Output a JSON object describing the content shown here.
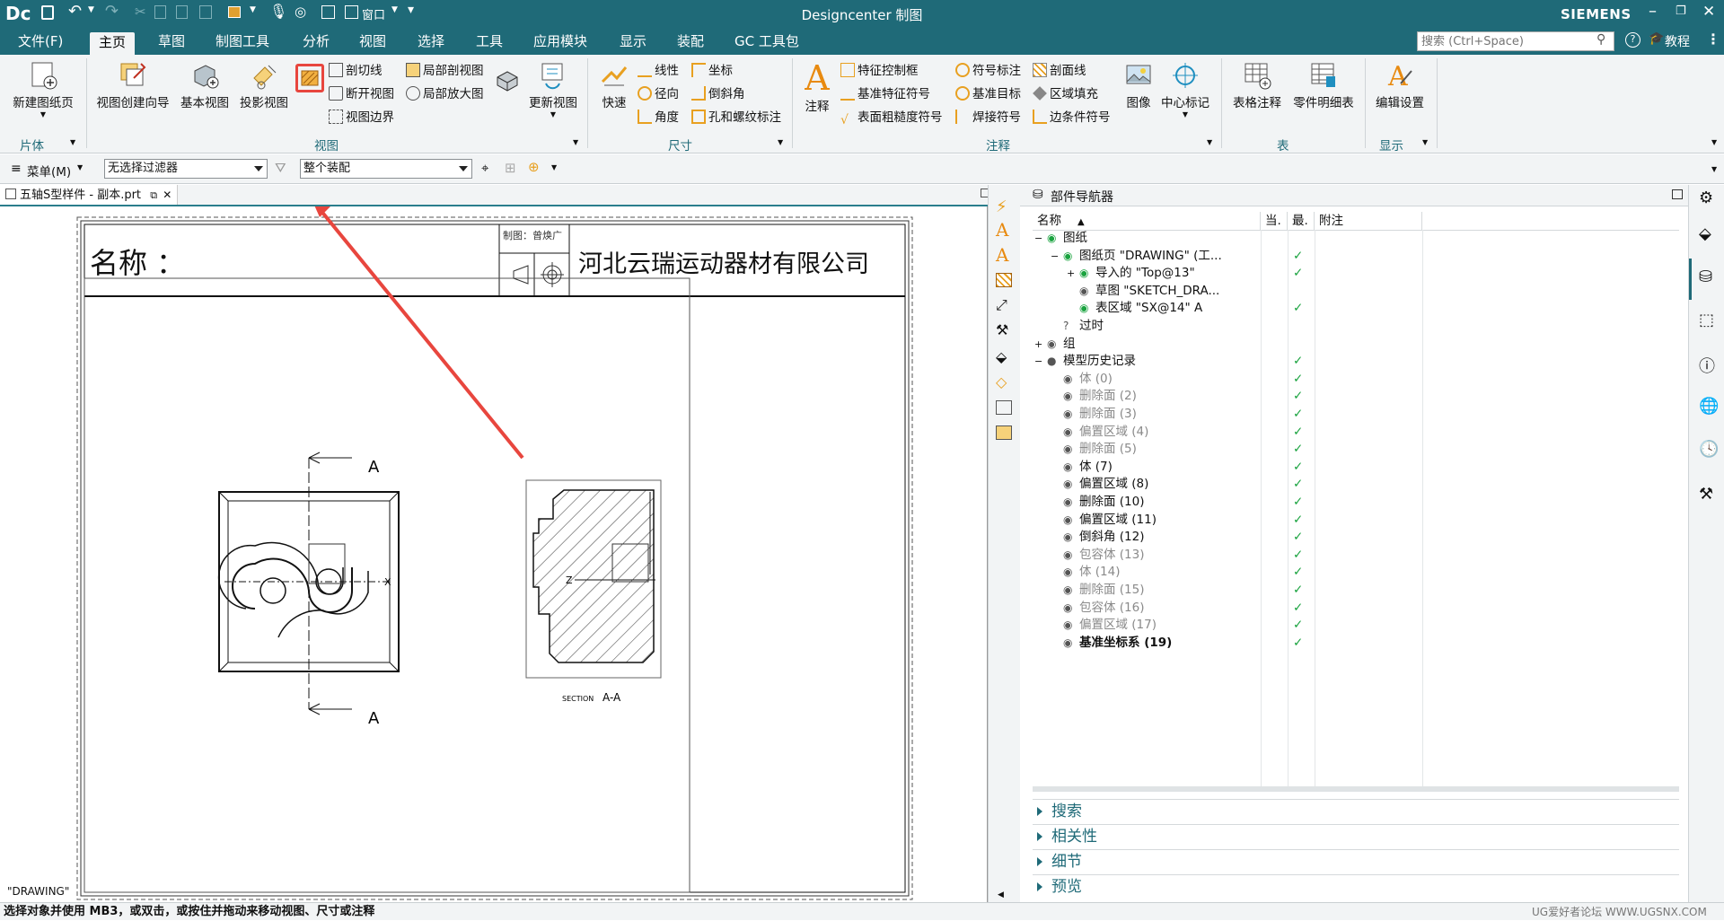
{
  "titlebar": {
    "logo": "Dc",
    "title": "Designcenter 制图",
    "brand": "SIEMENS",
    "window_label": "窗口"
  },
  "menu": {
    "items": [
      "文件(F)",
      "主页",
      "草图",
      "制图工具",
      "分析",
      "视图",
      "选择",
      "工具",
      "应用模块",
      "显示",
      "装配",
      "GC 工具包"
    ],
    "search_placeholder": "搜索 (Ctrl+Space)",
    "tutorial": "教程"
  },
  "ribbon": {
    "new_sheet": "新建图纸页",
    "group_piece": "片体",
    "view_wizard": "视图创建向导",
    "base_view": "基本视图",
    "projected_view": "投影视图",
    "section_line": "剖切线",
    "break_view": "断开视图",
    "view_boundary": "视图边界",
    "local_section": "局部剖视图",
    "detail_view": "局部放大图",
    "update_view": "更新视图",
    "group_view": "视图",
    "rapid": "快速",
    "linear": "线性",
    "radial": "径向",
    "angle": "角度",
    "coordinate": "坐标",
    "chamfer": "倒斜角",
    "hole_thread": "孔和螺纹标注",
    "group_dim": "尺寸",
    "note": "注释",
    "fcf": "特征控制框",
    "datum_symbol": "基准特征符号",
    "surface_finish": "表面粗糙度符号",
    "id_symbol": "符号标注",
    "datum_target": "基准目标",
    "weld_symbol": "焊接符号",
    "hatch": "剖面线",
    "area_fill": "区域填充",
    "edge_symbol": "边条件符号",
    "image": "图像",
    "center_mark": "中心标记",
    "group_note": "注释",
    "table_note": "表格注释",
    "parts_list": "零件明细表",
    "group_table": "表",
    "edit_settings": "编辑设置",
    "group_display": "显示"
  },
  "filterbar": {
    "menu": "菜单(M)",
    "filter": "无选择过滤器",
    "assembly": "整个装配"
  },
  "document": {
    "tab": "五轴S型样件 - 副本.prt",
    "sheet_label": "\"DRAWING\"",
    "title_name": "名称 ：",
    "company": "河北云瑞运动器材有限公司",
    "drawn_by": "制图：曾焕广",
    "sec_label_top": "A",
    "sec_label_bottom": "A",
    "section_caption_small": "SECTION",
    "section_caption": "A-A",
    "axis_x": "X",
    "axis_z": "Z"
  },
  "navigator": {
    "title": "部件导航器",
    "columns": [
      "名称",
      "当.",
      "最.",
      "附注"
    ],
    "rows": [
      {
        "label": "图纸",
        "style": "normal",
        "check": false
      },
      {
        "label": "图纸页 \"DRAWING\" (工...",
        "style": "normal",
        "check": true
      },
      {
        "label": "导入的 \"Top@13\"",
        "style": "normal",
        "check": true
      },
      {
        "label": "草图 \"SKETCH_DRA...",
        "style": "normal",
        "check": false
      },
      {
        "label": "表区域 \"SX@14\" A",
        "style": "normal",
        "check": true
      },
      {
        "label": "过时",
        "style": "normal",
        "check": false
      },
      {
        "label": "组",
        "style": "normal",
        "check": false
      },
      {
        "label": "模型历史记录",
        "style": "normal",
        "check": true
      },
      {
        "label": "体 (0)",
        "style": "gray",
        "check": true
      },
      {
        "label": "删除面 (2)",
        "style": "gray",
        "check": true
      },
      {
        "label": "删除面 (3)",
        "style": "gray",
        "check": true
      },
      {
        "label": "偏置区域 (4)",
        "style": "gray",
        "check": true
      },
      {
        "label": "删除面 (5)",
        "style": "gray",
        "check": true
      },
      {
        "label": "体 (7)",
        "style": "normal",
        "check": true
      },
      {
        "label": "偏置区域 (8)",
        "style": "normal",
        "check": true
      },
      {
        "label": "删除面 (10)",
        "style": "normal",
        "check": true
      },
      {
        "label": "偏置区域 (11)",
        "style": "normal",
        "check": true
      },
      {
        "label": "倒斜角 (12)",
        "style": "normal",
        "check": true
      },
      {
        "label": "包容体 (13)",
        "style": "gray",
        "check": true
      },
      {
        "label": "体 (14)",
        "style": "gray",
        "check": true
      },
      {
        "label": "删除面 (15)",
        "style": "gray",
        "check": true
      },
      {
        "label": "包容体 (16)",
        "style": "gray",
        "check": true
      },
      {
        "label": "偏置区域 (17)",
        "style": "gray",
        "check": true
      },
      {
        "label": "基准坐标系 (19)",
        "style": "bold",
        "check": true
      }
    ],
    "sections": [
      "搜索",
      "相关性",
      "细节",
      "预览"
    ]
  },
  "status": {
    "text": "选择对象并使用 MB3，或双击，或按住并拖动来移动视图、尺寸或注释",
    "watermark": "UG爱好者论坛 WWW.UGSNX.COM"
  },
  "colors": {
    "accent": "#1f6a78",
    "ribbon_bg": "#f2f4f5",
    "check": "#1aa33f",
    "highlight": "#e8463e"
  }
}
